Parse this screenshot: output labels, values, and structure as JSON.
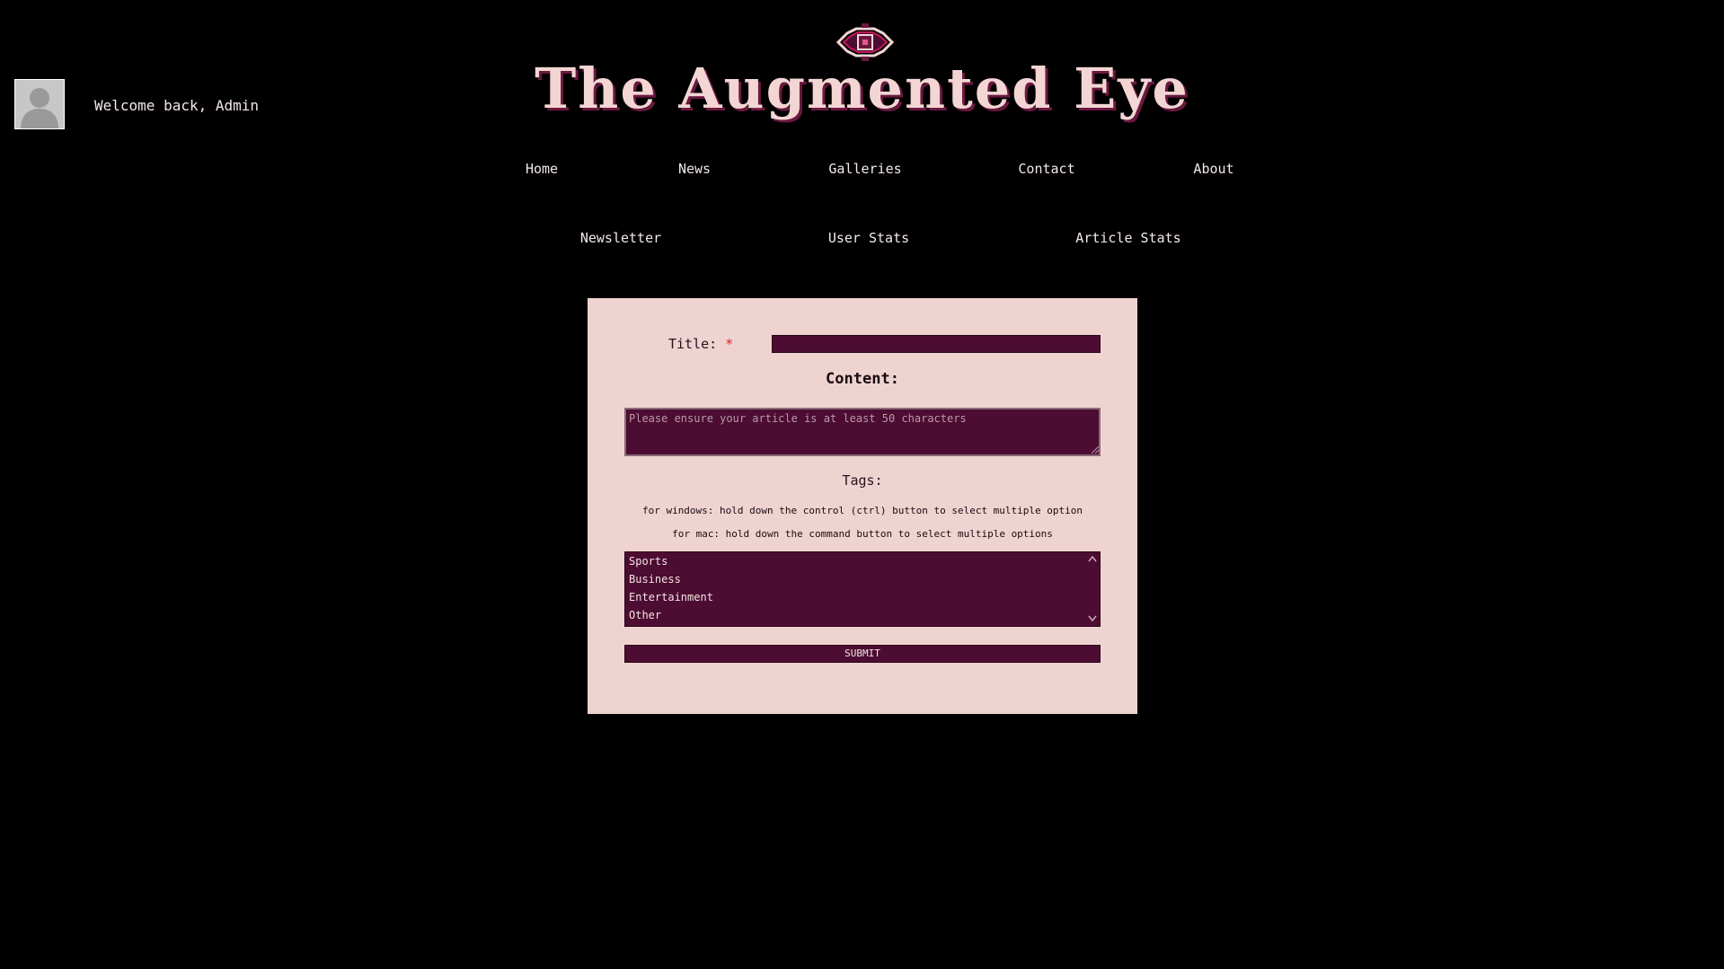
{
  "user": {
    "welcome_text": "Welcome back, Admin",
    "avatar_icon": "default-user-avatar"
  },
  "site": {
    "title": "The Augmented Eye",
    "logo_icon": "eye-icon"
  },
  "nav": {
    "row1": [
      "Home",
      "News",
      "Galleries",
      "Contact",
      "About"
    ],
    "row2": [
      "Newsletter",
      "User Stats",
      "Article Stats"
    ]
  },
  "form": {
    "title_label": "Title:",
    "required_mark": "*",
    "title_value": "",
    "content_label": "Content:",
    "content_placeholder": "Please ensure your article is at least 50 characters",
    "tags_label": "Tags:",
    "hint_windows": "for windows: hold down the control (ctrl) button to select multiple option",
    "hint_mac": "for mac: hold down the command button to select multiple options",
    "tag_options": [
      "Sports",
      "Business",
      "Entertainment",
      "Other"
    ],
    "submit_label": "SUBMIT"
  },
  "colors": {
    "background": "#000000",
    "panel": "#efd3d0",
    "field": "#4d0c31",
    "title_text": "#f3d6d4",
    "title_shadow": "#6b1840",
    "required": "#e02020"
  }
}
